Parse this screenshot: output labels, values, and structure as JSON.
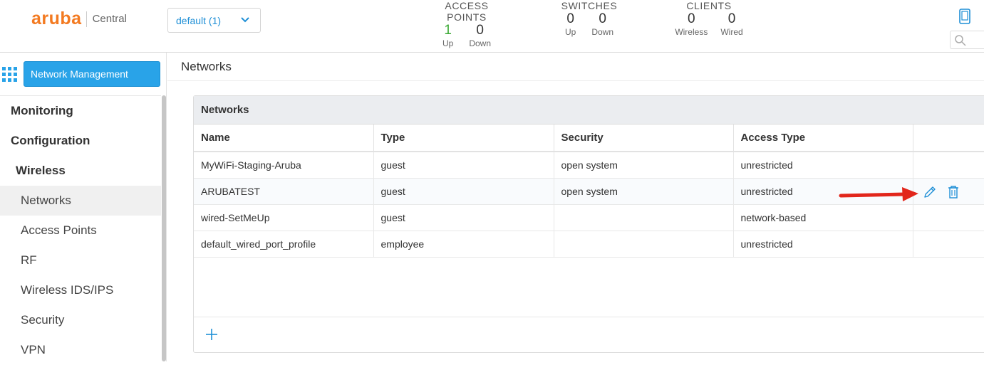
{
  "header": {
    "logo": "aruba",
    "product": "Central",
    "group_select": "default (1)",
    "stats": {
      "access_points": {
        "title": "ACCESS POINTS",
        "up_value": "1",
        "up_label": "Up",
        "down_value": "0",
        "down_label": "Down"
      },
      "switches": {
        "title": "SWITCHES",
        "up_value": "0",
        "up_label": "Up",
        "down_value": "0",
        "down_label": "Down"
      },
      "clients": {
        "title": "CLIENTS",
        "wireless_value": "0",
        "wireless_label": "Wireless",
        "wired_value": "0",
        "wired_label": "Wired"
      }
    },
    "colors": {
      "brand": "#f37a21",
      "up_green": "#3aa934",
      "link_blue": "#1f8fd6"
    }
  },
  "sidebar": {
    "app_button": "Network Management",
    "items": [
      {
        "label": "Monitoring",
        "level": "section"
      },
      {
        "label": "Configuration",
        "level": "section"
      },
      {
        "label": "Wireless",
        "level": "subsection"
      },
      {
        "label": "Networks",
        "level": "leaf",
        "active": true
      },
      {
        "label": "Access Points",
        "level": "leaf"
      },
      {
        "label": "RF",
        "level": "leaf"
      },
      {
        "label": "Wireless IDS/IPS",
        "level": "leaf"
      },
      {
        "label": "Security",
        "level": "leaf"
      },
      {
        "label": "VPN",
        "level": "leaf"
      }
    ]
  },
  "main": {
    "page_title": "Networks",
    "card_title": "Networks",
    "columns": [
      "Name",
      "Type",
      "Security",
      "Access Type",
      ""
    ],
    "rows": [
      [
        "MyWiFi-Staging-Aruba",
        "guest",
        "open system",
        "unrestricted"
      ],
      [
        "ARUBATEST",
        "guest",
        "open system",
        "unrestricted"
      ],
      [
        "wired-SetMeUp",
        "guest",
        "",
        "network-based"
      ],
      [
        "default_wired_port_profile",
        "employee",
        "",
        "unrestricted"
      ]
    ],
    "actions": {
      "edit_icon": "pencil-icon",
      "delete_icon": "trash-icon",
      "add_icon": "plus-icon"
    }
  }
}
